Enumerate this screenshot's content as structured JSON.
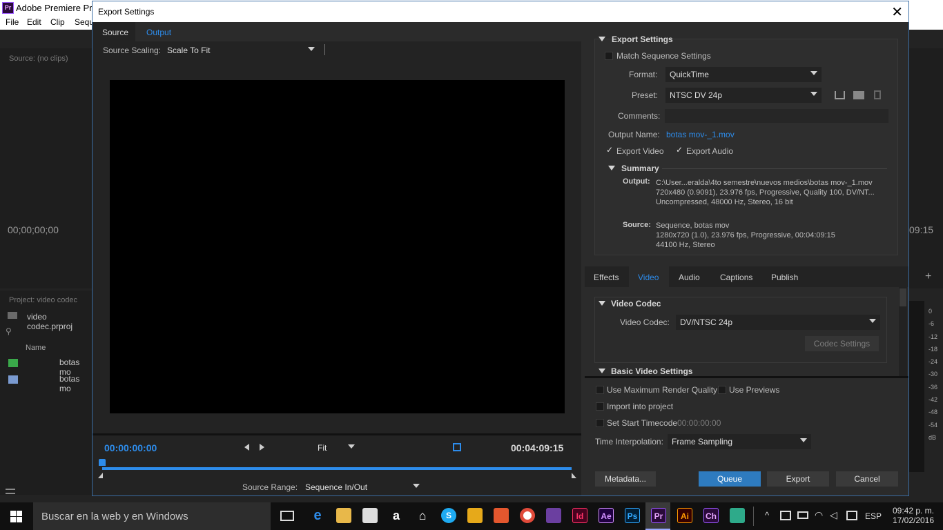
{
  "app": {
    "title": "Adobe Premiere Pro",
    "logo": "Pr",
    "menu": [
      "File",
      "Edit",
      "Clip",
      "Sequ"
    ],
    "source_panel": "Source: (no clips)",
    "timecode_left": "00;00;00;00",
    "timecode_right": "09:15",
    "project_panel": "Project: video codec",
    "project_file": "video codec.prproj",
    "name_header": "Name",
    "items": [
      "botas mo",
      "botas mo"
    ],
    "meter_ticks": [
      "0",
      "-6",
      "-12",
      "-18",
      "-24",
      "-30",
      "-36",
      "-42",
      "-48",
      "-54",
      "dB"
    ],
    "plus": "+"
  },
  "dialog": {
    "title": "Export Settings",
    "close": "✕",
    "tabs": [
      "Source",
      "Output"
    ],
    "source_scaling_label": "Source Scaling:",
    "source_scaling_value": "Scale To Fit",
    "timecode_start": "00:00:00:00",
    "timecode_end": "00:04:09:15",
    "zoom_value": "Fit",
    "source_range_label": "Source Range:",
    "source_range_value": "Sequence In/Out",
    "playhead_fraction": 0.0
  },
  "export_settings": {
    "section": "Export Settings",
    "match_sequence": "Match Sequence Settings",
    "format_label": "Format:",
    "format_value": "QuickTime",
    "preset_label": "Preset:",
    "preset_value": "NTSC DV 24p",
    "comments_label": "Comments:",
    "output_name_label": "Output Name:",
    "output_name_value": "botas mov-_1.mov",
    "export_video": "Export Video",
    "export_audio": "Export Audio",
    "summary": "Summary",
    "output_label": "Output:",
    "output_lines": [
      "C:\\User...eralda\\4to semestre\\nuevos medios\\botas mov-_1.mov",
      "720x480 (0.9091), 23.976 fps, Progressive, Quality 100, DV/NT...",
      "Uncompressed, 48000 Hz, Stereo, 16 bit"
    ],
    "source_label": "Source:",
    "source_lines": [
      "Sequence, botas mov",
      "1280x720 (1.0), 23.976 fps, Progressive, 00:04:09:15",
      "44100 Hz, Stereo"
    ]
  },
  "panel_tabs": [
    "Effects",
    "Video",
    "Audio",
    "Captions",
    "Publish"
  ],
  "video": {
    "codec_section": "Video Codec",
    "codec_label": "Video Codec:",
    "codec_value": "DV/NTSC 24p",
    "codec_settings": "Codec Settings",
    "basic_section": "Basic Video Settings"
  },
  "bottom": {
    "max_render": "Use Maximum Render Quality",
    "use_previews": "Use Previews",
    "import_project": "Import into project",
    "set_start_tc": "Set Start Timecode",
    "start_tc_value": "00:00:00:00",
    "time_interp_label": "Time Interpolation:",
    "time_interp_value": "Frame Sampling",
    "metadata": "Metadata...",
    "queue": "Queue",
    "export": "Export",
    "cancel": "Cancel"
  },
  "taskbar": {
    "search": "Buscar en la web y en Windows",
    "apps": [
      "Id",
      "Ae",
      "Ps",
      "Pr",
      "Ai",
      "Ch"
    ],
    "lang": "ESP",
    "time": "09:42 p. m.",
    "date": "17/02/2016"
  },
  "colors": {
    "accent": "#2d8ceb",
    "queue_button": "#2e7bbf",
    "premiere": "#9b59ff"
  }
}
